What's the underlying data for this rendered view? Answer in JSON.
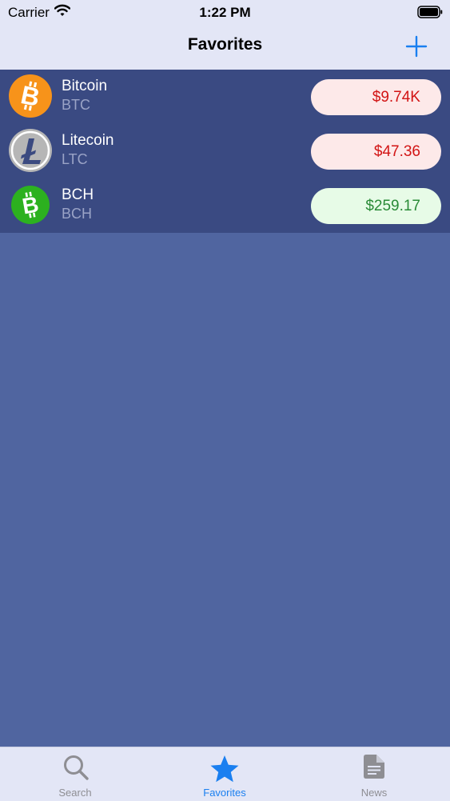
{
  "status_bar": {
    "carrier": "Carrier",
    "time": "1:22 PM"
  },
  "nav": {
    "title": "Favorites",
    "add_icon": "plus-icon"
  },
  "colors": {
    "accent": "#1a7ff0",
    "tab_inactive": "#8e8e93",
    "price_down_text": "#d21414",
    "price_down_bg": "#fde9e9",
    "price_up_text": "#2a8b37",
    "price_up_bg": "#e7fbe7",
    "list_bg": "#3a4a82",
    "page_bg": "#5065a0"
  },
  "favorites": [
    {
      "name": "Bitcoin",
      "symbol": "BTC",
      "price": "$9.74K",
      "trend": "down",
      "icon": "bitcoin-icon"
    },
    {
      "name": "Litecoin",
      "symbol": "LTC",
      "price": "$47.36",
      "trend": "down",
      "icon": "litecoin-icon"
    },
    {
      "name": "BCH",
      "symbol": "BCH",
      "price": "$259.17",
      "trend": "up",
      "icon": "bitcoin-cash-icon"
    }
  ],
  "tabs": [
    {
      "label": "Search",
      "icon": "search-icon",
      "selected": false
    },
    {
      "label": "Favorites",
      "icon": "star-icon",
      "selected": true
    },
    {
      "label": "News",
      "icon": "document-icon",
      "selected": false
    }
  ]
}
